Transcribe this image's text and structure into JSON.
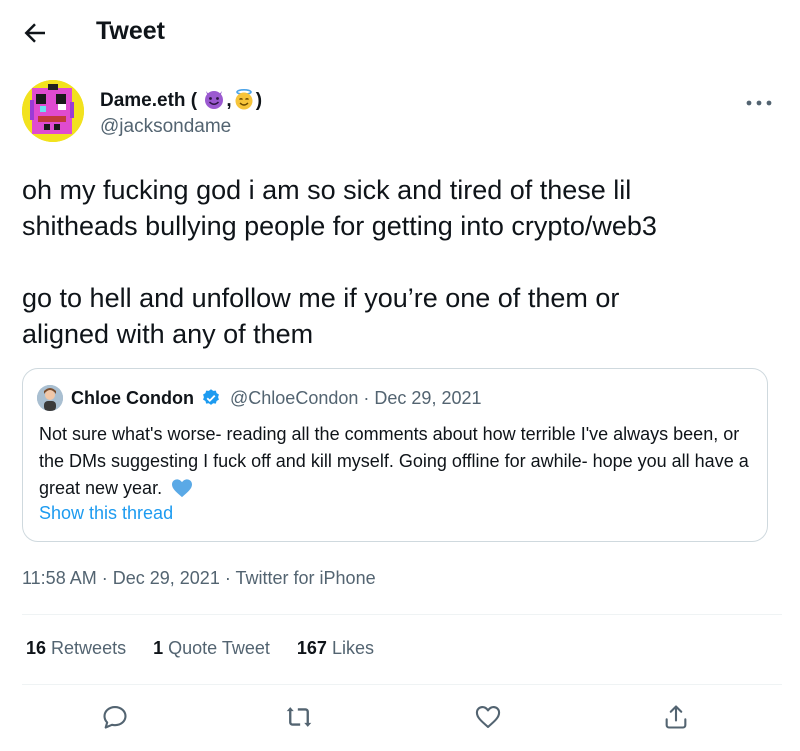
{
  "header": {
    "title": "Tweet"
  },
  "author": {
    "name": "Dame.eth (",
    "name_sep": ",",
    "name_end": ")",
    "handle": "@jacksondame"
  },
  "tweet": {
    "text": "oh my fucking god i am so sick and tired of these lil\nshitheads bullying people for getting into crypto/web3\n\ngo to hell and unfollow me if you’re one of them or\naligned with any of them"
  },
  "quote": {
    "name": "Chloe Condon",
    "handle": "@ChloeCondon",
    "separator": "·",
    "date": "Dec 29, 2021",
    "text": "Not sure what's worse- reading all the comments about how terrible I've always been, or the DMs suggesting I fuck off and kill myself. Going offline for awhile- hope you all have a great new year.",
    "link": "Show this thread"
  },
  "meta": {
    "time": "11:58 AM",
    "sep1": "·",
    "date": "Dec 29, 2021",
    "sep2": "·",
    "source": "Twitter for iPhone"
  },
  "stats": {
    "retweets_count": "16",
    "retweets_label": "Retweets",
    "quotes_count": "1",
    "quotes_label": "Quote Tweet",
    "likes_count": "167",
    "likes_label": "Likes"
  },
  "colors": {
    "accent": "#1d9bf0",
    "secondary_text": "#536471",
    "border": "#cfd9de"
  },
  "icons": [
    "back-arrow-icon",
    "more-icon",
    "verified-icon",
    "reply-icon",
    "retweet-icon",
    "like-icon",
    "share-icon"
  ]
}
